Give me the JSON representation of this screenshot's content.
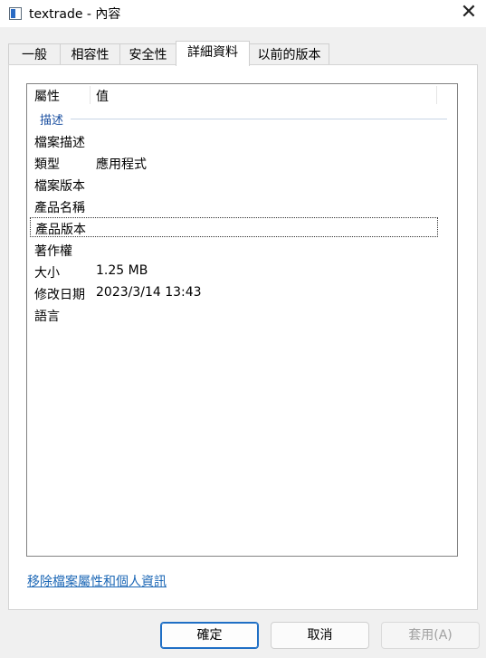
{
  "window": {
    "title": "textrade - 內容",
    "close_label": "✕"
  },
  "tabs": [
    {
      "label": "一般",
      "active": false
    },
    {
      "label": "相容性",
      "active": false
    },
    {
      "label": "安全性",
      "active": false
    },
    {
      "label": "詳細資料",
      "active": true
    },
    {
      "label": "以前的版本",
      "active": false
    }
  ],
  "details": {
    "header_property": "屬性",
    "header_value": "值",
    "group_label": "描述",
    "rows": [
      {
        "name": "檔案描述",
        "value": ""
      },
      {
        "name": "類型",
        "value": "應用程式"
      },
      {
        "name": "檔案版本",
        "value": ""
      },
      {
        "name": "產品名稱",
        "value": ""
      },
      {
        "name": "產品版本",
        "value": "",
        "focused": true
      },
      {
        "name": "著作權",
        "value": ""
      },
      {
        "name": "大小",
        "value": "1.25 MB"
      },
      {
        "name": "修改日期",
        "value": "2023/3/14 13:43"
      },
      {
        "name": "語言",
        "value": ""
      }
    ]
  },
  "remove_link": "移除檔案屬性和個人資訊",
  "buttons": {
    "ok": "確定",
    "cancel": "取消",
    "apply": "套用(A)"
  }
}
